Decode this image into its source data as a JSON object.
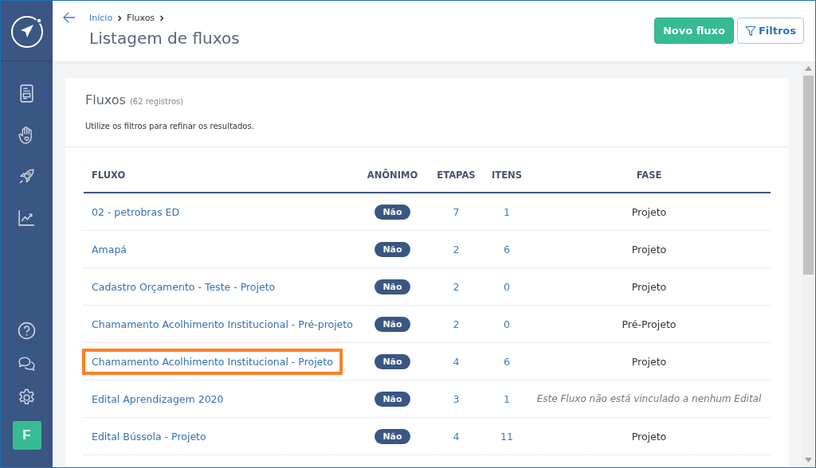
{
  "sidebar": {
    "avatar": "F"
  },
  "header": {
    "breadcrumb": [
      {
        "label": "Início",
        "link": true
      },
      {
        "label": "Fluxos",
        "link": false
      }
    ],
    "title": "Listagem de fluxos",
    "buttons": [
      {
        "label": "Novo fluxo",
        "kind": "primary"
      },
      {
        "label": "Filtros",
        "kind": "filter"
      }
    ]
  },
  "card": {
    "title": "Fluxos",
    "count": "(62 registros)",
    "hint": "Utilize os filtros para refinar os resultados."
  },
  "table": {
    "columns": [
      "FLUXO",
      "ANÔNIMO",
      "ETAPAS",
      "ITENS",
      "FASE"
    ],
    "rows": [
      {
        "name": "02 - petrobras ED",
        "anonymous": "Não",
        "steps": "7",
        "items": "1",
        "phase": "Projeto",
        "unlinked": false,
        "highlighted": false
      },
      {
        "name": "Amapá",
        "anonymous": "Não",
        "steps": "2",
        "items": "6",
        "phase": "Projeto",
        "unlinked": false,
        "highlighted": false
      },
      {
        "name": "Cadastro Orçamento - Teste - Projeto",
        "anonymous": "Não",
        "steps": "2",
        "items": "0",
        "phase": "Projeto",
        "unlinked": false,
        "highlighted": false
      },
      {
        "name": "Chamamento Acolhimento Institucional - Pré-projeto",
        "anonymous": "Não",
        "steps": "2",
        "items": "0",
        "phase": "Pré-Projeto",
        "unlinked": false,
        "highlighted": false
      },
      {
        "name": "Chamamento Acolhimento Institucional - Projeto",
        "anonymous": "Não",
        "steps": "4",
        "items": "6",
        "phase": "Projeto",
        "unlinked": false,
        "highlighted": true
      },
      {
        "name": "Edital Aprendizagem 2020",
        "anonymous": "Não",
        "steps": "3",
        "items": "1",
        "phase": "Este Fluxo não está vinculado a nenhum Edital",
        "unlinked": true,
        "highlighted": false
      },
      {
        "name": "Edital Bússola - Projeto",
        "anonymous": "Não",
        "steps": "4",
        "items": "11",
        "phase": "Projeto",
        "unlinked": false,
        "highlighted": false
      }
    ]
  }
}
